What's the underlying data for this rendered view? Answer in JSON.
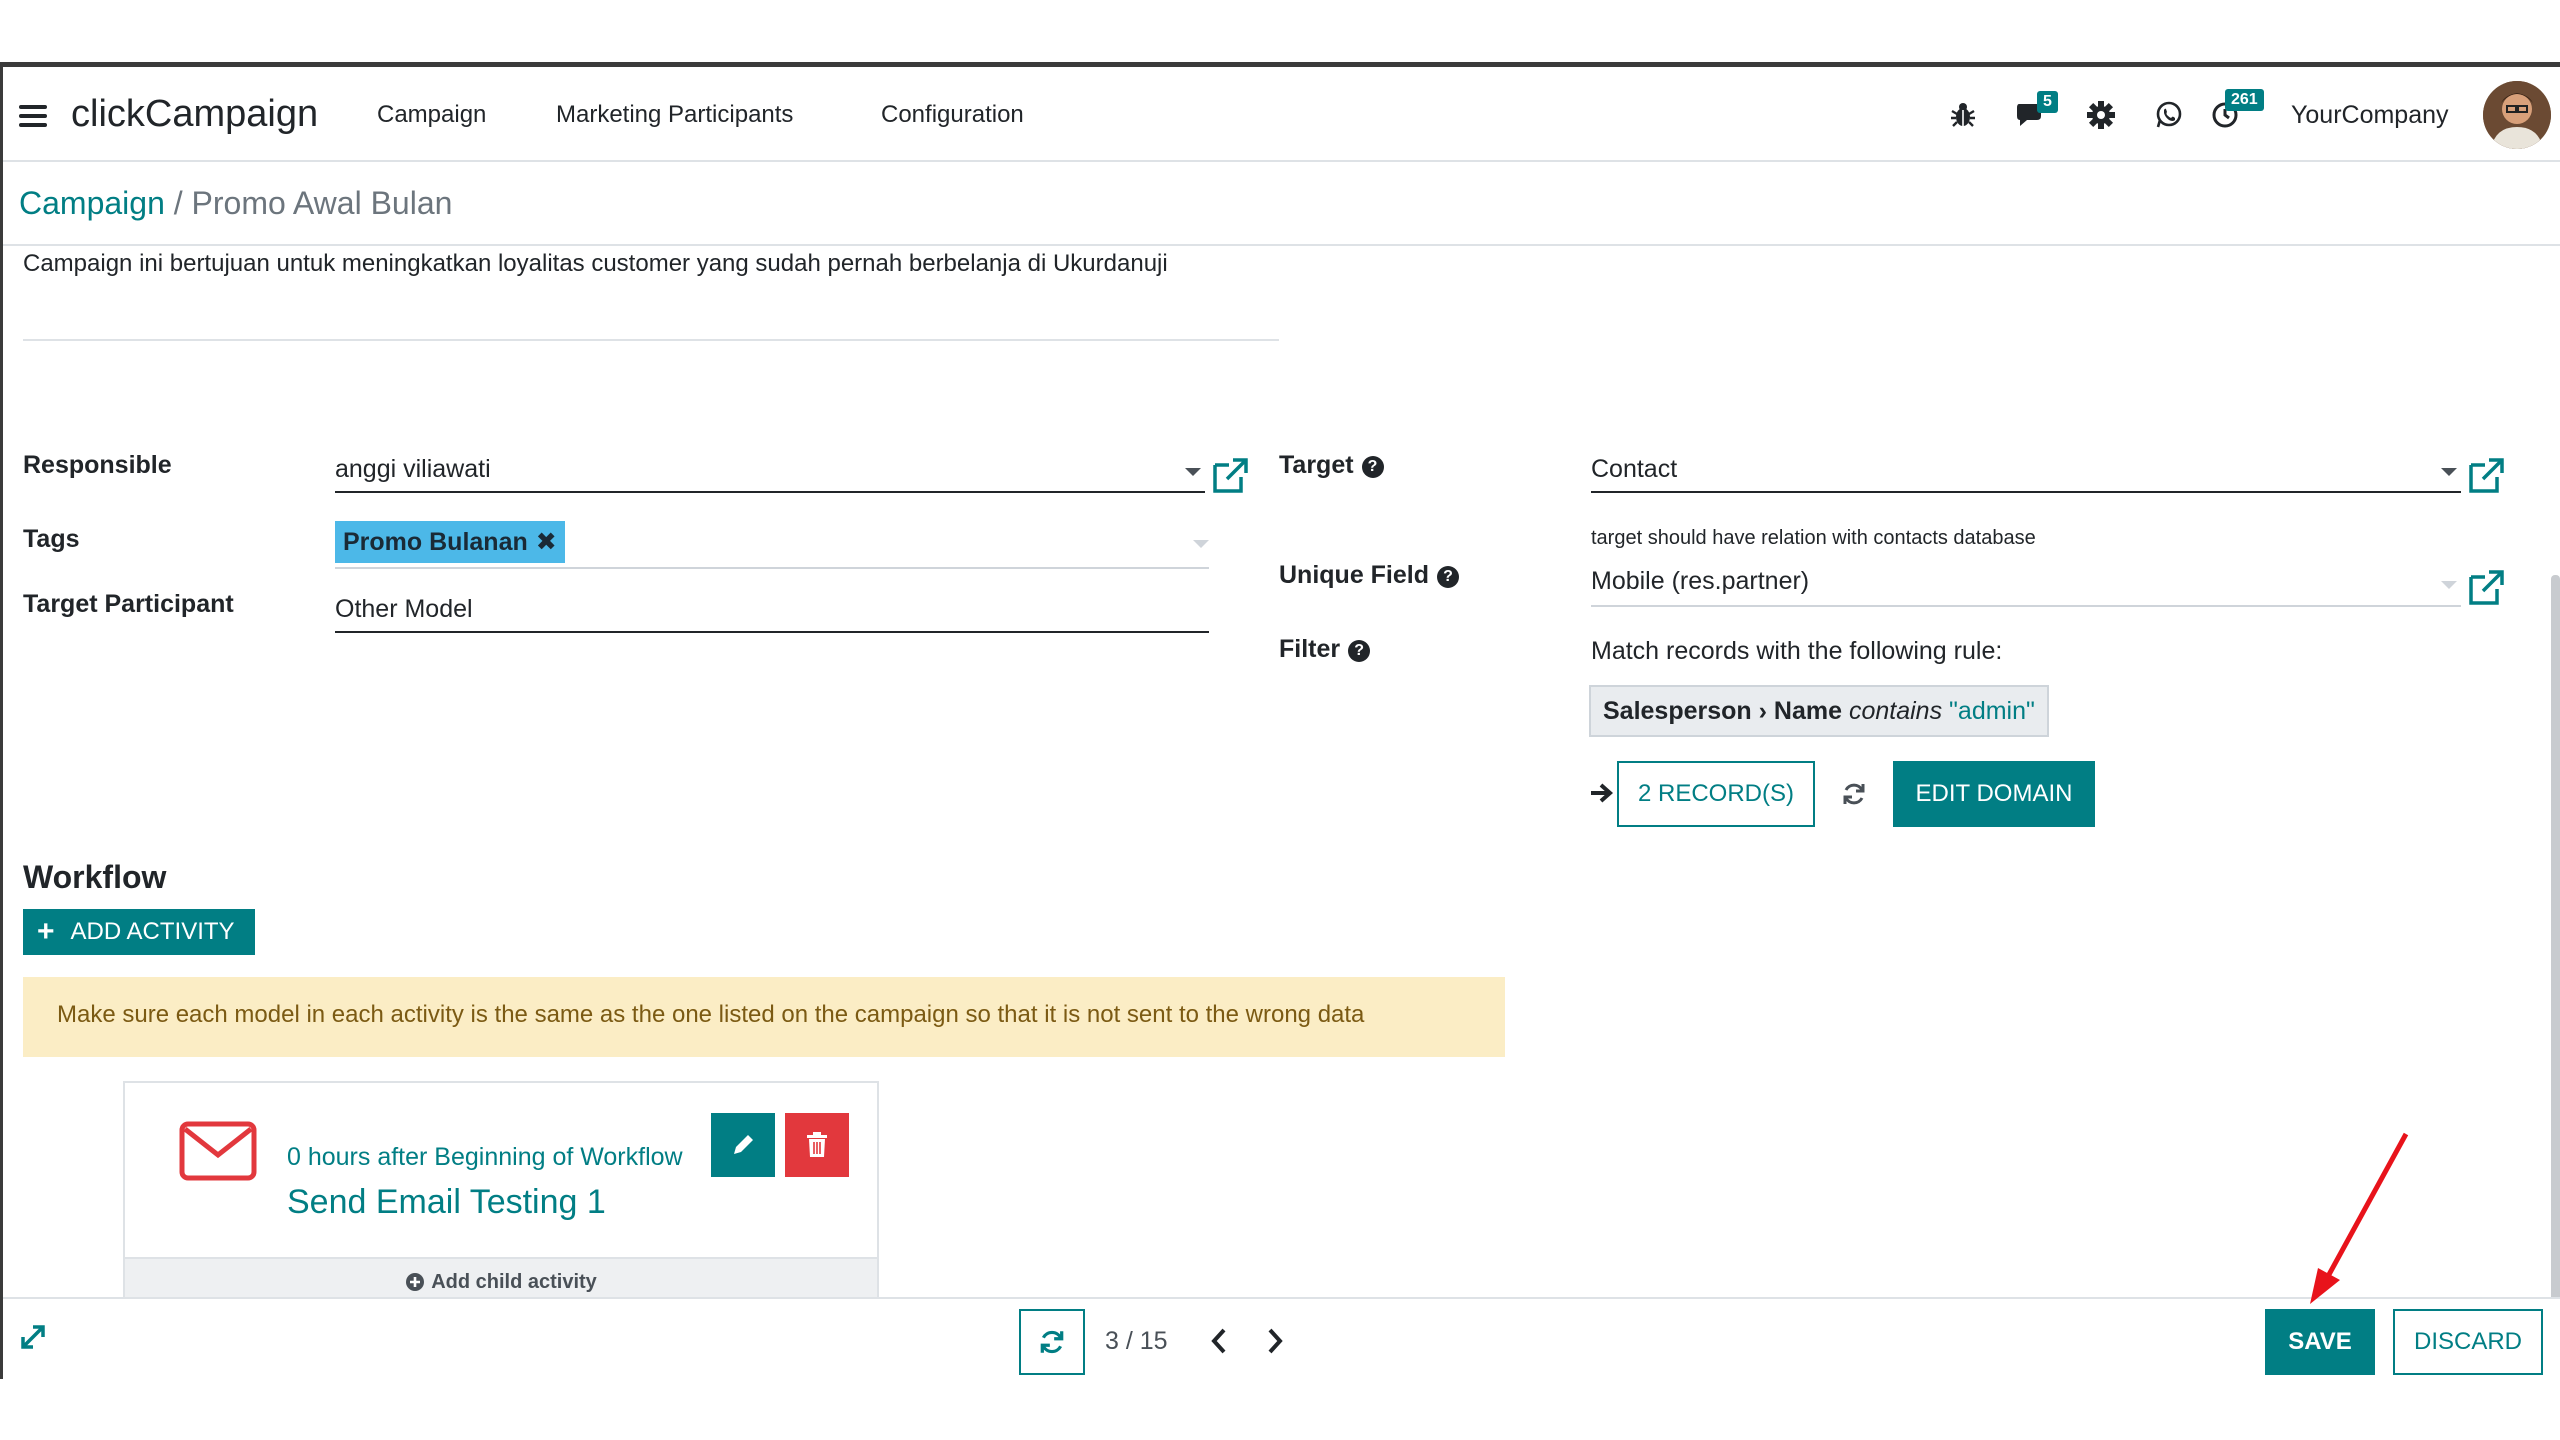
{
  "navbar": {
    "app_name": "clickCampaign",
    "menus": [
      "Campaign",
      "Marketing Participants",
      "Configuration"
    ],
    "messages_badge": "5",
    "activities_badge": "261",
    "company": "YourCompany"
  },
  "breadcrumb": {
    "parent": "Campaign",
    "separator": " / ",
    "current": "Promo Awal Bulan"
  },
  "form": {
    "description": "Campaign ini bertujuan untuk meningkatkan loyalitas customer yang sudah pernah berbelanja di Ukurdanuji",
    "responsible_label": "Responsible",
    "responsible_value": "anggi viliawati",
    "tags_label": "Tags",
    "tag_value": "Promo Bulanan",
    "target_participant_label": "Target Participant",
    "target_participant_value": "Other Model",
    "target_label": "Target",
    "target_value": "Contact",
    "target_note": "target should have relation with contacts database",
    "unique_field_label": "Unique Field",
    "unique_field_value": "Mobile (res.partner)",
    "filter_label": "Filter",
    "filter_rule_text": "Match records with the following rule:",
    "domain_field": "Salesperson",
    "domain_subfield": "Name",
    "domain_operator": "contains",
    "domain_value": "\"admin\"",
    "records_button": "2 RECORD(S)",
    "edit_domain_button": "EDIT DOMAIN"
  },
  "workflow": {
    "heading": "Workflow",
    "add_activity_button": "ADD ACTIVITY",
    "alert": "Make sure each model in each activity is the same as the one listed on the campaign so that it is not sent to the wrong data",
    "activity_timing": "0 hours after Beginning of Workflow",
    "activity_name": "Send Email Testing 1",
    "add_child": "Add child activity"
  },
  "pager": {
    "text": "3 / 15"
  },
  "footer": {
    "save": "SAVE",
    "discard": "DISCARD"
  },
  "colors": {
    "primary": "#017e84",
    "danger": "#e2383d",
    "alert_bg": "#fbedc5",
    "tag_bg": "#4cb8e8",
    "annotation_arrow": "#e8131b"
  }
}
